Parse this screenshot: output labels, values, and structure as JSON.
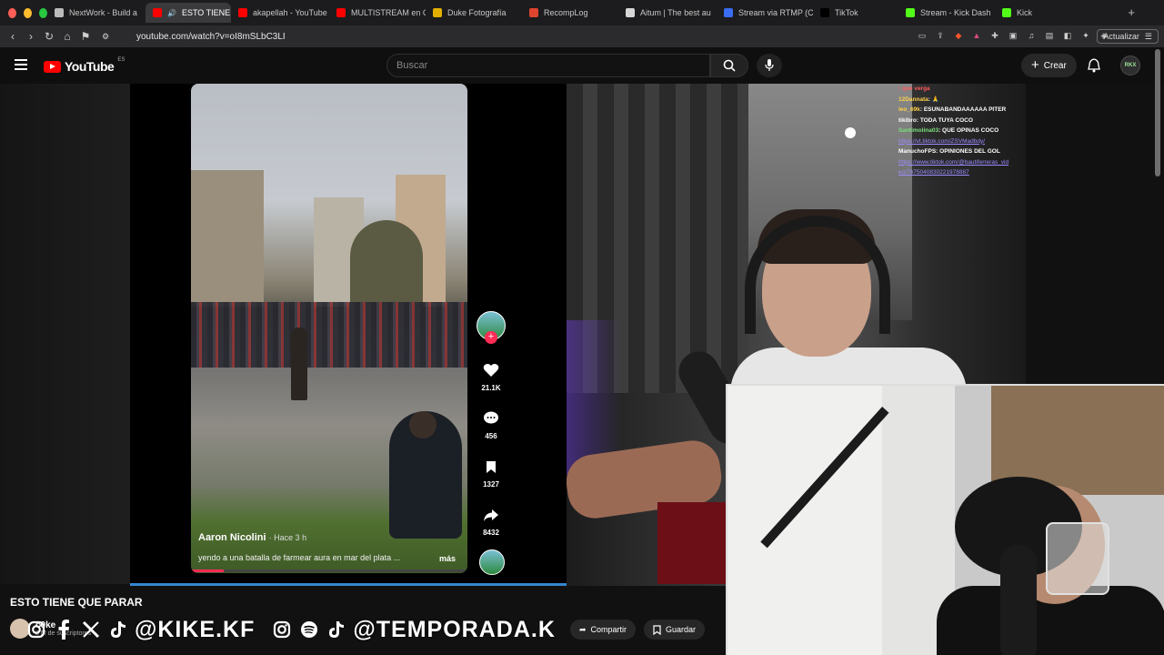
{
  "browser": {
    "tabs": [
      {
        "label": "NextWork - Build a",
        "fav": "#bbbbbb",
        "active": false
      },
      {
        "label": "ESTO TIENE",
        "fav": "#ff0000",
        "active": true,
        "audio": true
      },
      {
        "label": "akapellah - YouTube",
        "fav": "#ff0000",
        "active": false
      },
      {
        "label": "MULTISTREAM en C",
        "fav": "#ff0000",
        "active": false
      },
      {
        "label": "Duke Fotografía",
        "fav": "#e2b100",
        "active": false
      },
      {
        "label": "RecompLog",
        "fav": "#e0442f",
        "active": false
      },
      {
        "label": "Aitum | The best au",
        "fav": "#d6d6d6",
        "active": false
      },
      {
        "label": "Stream via RTMP (C",
        "fav": "#3a6df0",
        "active": false
      },
      {
        "label": "TikTok",
        "fav": "#000000",
        "active": false
      },
      {
        "label": "Stream - Kick Dash",
        "fav": "#53fc18",
        "active": false
      },
      {
        "label": "Kick",
        "fav": "#53fc18",
        "active": false
      }
    ],
    "new_tab": "+",
    "url": "youtube.com/watch?v=oI8mSLbC3LI",
    "update_label": "Actualizar"
  },
  "youtube": {
    "logo_text": "YouTube",
    "country": "ES",
    "search_placeholder": "Buscar",
    "create_label": "Crear",
    "avatar_text": "RKX"
  },
  "clip": {
    "author": "Aaron Nicolini",
    "time": "· Hace 3 h",
    "description": "yendo a una batalla de farmear aura en mar del plata ...",
    "more": "más",
    "likes": "21.1K",
    "comments": "456",
    "saves": "1327",
    "shares": "8432",
    "progress": 0.12
  },
  "chat": [
    {
      "user": "",
      "text": ": que verga",
      "color": "#ff5a5a"
    },
    {
      "user": "12Dannata",
      "text": ": 🙏",
      "color": "#ffd24a"
    },
    {
      "user": "leo_69k",
      "text": ": ESUNABANDAAAAAA PITER",
      "color": "#ffd24a"
    },
    {
      "user": "tikibro",
      "text": ": TODA TUYA COCO",
      "color": "#ffffff"
    },
    {
      "user": "Santimolina03",
      "text": ": QUE OPINAS COCO",
      "color": "#7be07b"
    },
    {
      "user": "",
      "text": "https://vt.tiktok.com/ZSVMadbdy/",
      "color": "#9b8cff",
      "link": true
    },
    {
      "user": "ManuchoFPS",
      "text": ": OPINIONES DEL GOL",
      "color": "#ffffff"
    },
    {
      "user": "",
      "text": "https://www.tiktok.com/@bautiferreras_vid",
      "color": "#9b8cff",
      "link": true
    },
    {
      "user": "",
      "text": "eo/7675040830221978887",
      "color": "#9b8cff",
      "link": true
    }
  ],
  "video": {
    "title": "ESTO TIENE QUE PARAR",
    "channel_name": "c0ke",
    "subscribers": "8 M de suscriptores",
    "share_label": "Compartir",
    "save_label": "Guardar"
  },
  "social": {
    "handle1": "@KIKE.KF",
    "handle2": "@TEMPORADA.K"
  },
  "colors": {
    "youtube_red": "#ff0000",
    "tiktok_pink": "#fe2c55",
    "accent_blue": "#3ea6ff"
  }
}
